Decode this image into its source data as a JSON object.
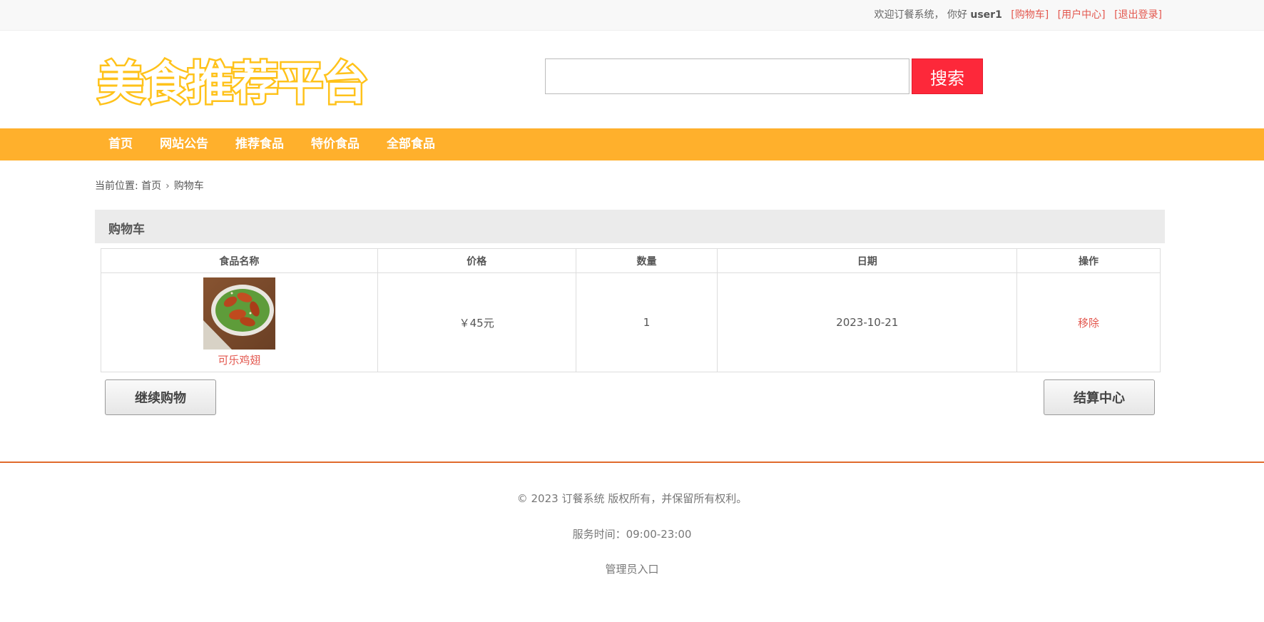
{
  "topbar": {
    "welcome": "欢迎订餐系统，",
    "greeting": "你好",
    "username": "user1",
    "links": [
      "[购物车]",
      "[用户中心]",
      "[退出登录]"
    ]
  },
  "logo": {
    "text": "美食推荐平台",
    "color": "#ffc21a"
  },
  "search": {
    "value": "",
    "button": "搜索"
  },
  "nav": [
    "首页",
    "网站公告",
    "推荐食品",
    "特价食品",
    "全部食品"
  ],
  "breadcrumb": {
    "prefix": "当前位置:",
    "home": "首页",
    "current": "购物车"
  },
  "panel_title": "购物车",
  "table": {
    "headers": [
      "食品名称",
      "价格",
      "数量",
      "日期",
      "操作"
    ],
    "rows": [
      {
        "name": "可乐鸡翅",
        "price": "￥45元",
        "qty": "1",
        "date": "2023-10-21",
        "action": "移除"
      }
    ]
  },
  "buttons": {
    "continue": "继续购物",
    "checkout": "结算中心"
  },
  "footer": {
    "copyright": "© 2023 订餐系统 版权所有，并保留所有权利。",
    "hours": "服务时间：09:00-23:00",
    "admin": "管理员入口"
  },
  "colors": {
    "nav_bg": "#ffb02c",
    "search_btn": "#fd283a",
    "link": "#e3574e",
    "footer_line": "#e06a2b"
  }
}
